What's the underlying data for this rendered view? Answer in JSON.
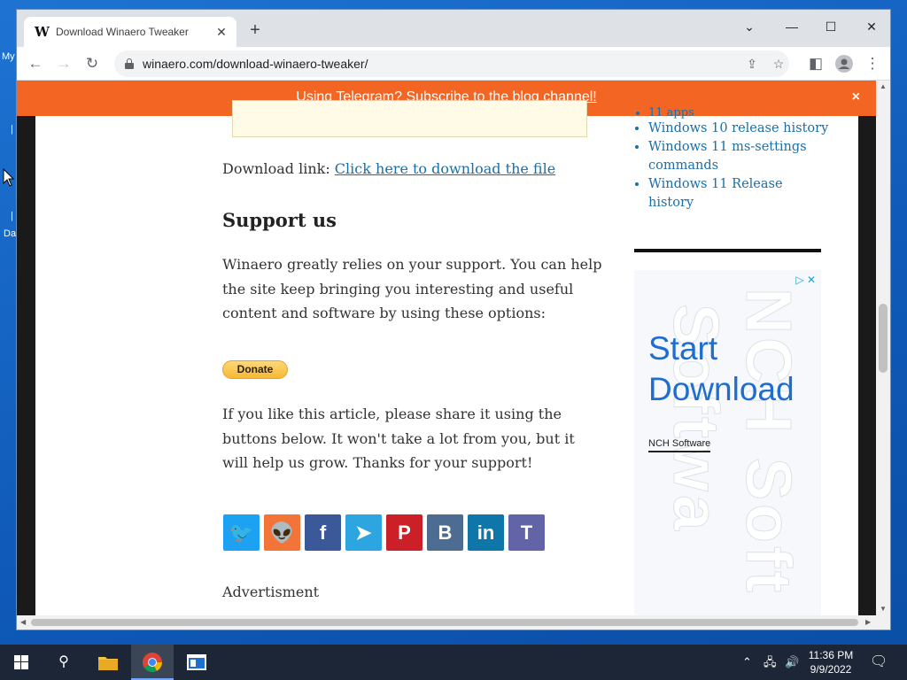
{
  "desktop": {
    "label_1": "My",
    "label_2": "Da"
  },
  "browser": {
    "tab_title": "Download Winaero Tweaker",
    "favicon_letter": "W",
    "url": "winaero.com/download-winaero-tweaker/"
  },
  "banner": {
    "text_before": "Using Telegram? Subscribe to the ",
    "link": "blog channel!",
    "close": "×"
  },
  "article": {
    "download_prefix": "Download link: ",
    "download_link": "Click here to download the file",
    "support_heading": "Support us",
    "support_text": "Winaero greatly relies on your support. You can help the site keep bringing you interesting and useful content and software by using these options:",
    "donate_label": "Donate",
    "share_text": "If you like this article, please share it using the buttons below. It won't take a lot from you, but it will help us grow. Thanks for your support!",
    "advert_label": "Advertisment"
  },
  "share_buttons": [
    {
      "name": "twitter",
      "glyph": "🐦",
      "color": "#1da1f2"
    },
    {
      "name": "reddit",
      "glyph": "👽",
      "color": "#f27438"
    },
    {
      "name": "facebook",
      "glyph": "f",
      "color": "#3b5998"
    },
    {
      "name": "telegram",
      "glyph": "➤",
      "color": "#2ca5e0"
    },
    {
      "name": "pinterest",
      "glyph": "P",
      "color": "#cb2027"
    },
    {
      "name": "vk",
      "glyph": "B",
      "color": "#4c6c91"
    },
    {
      "name": "linkedin",
      "glyph": "in",
      "color": "#0e76a8"
    },
    {
      "name": "teams",
      "glyph": "T",
      "color": "#6264a7"
    }
  ],
  "sidebar": {
    "items": [
      "11 apps",
      "Windows 10 release history",
      "Windows 11 ms-settings commands",
      "Windows 11 Release history"
    ]
  },
  "ad": {
    "headline_1": "Start",
    "headline_2": "Download",
    "brand": "NCH Software",
    "bg_text_1": "NCH Soft",
    "bg_text_2": "Softwa"
  },
  "taskbar": {
    "time": "11:36 PM",
    "date": "9/9/2022"
  }
}
